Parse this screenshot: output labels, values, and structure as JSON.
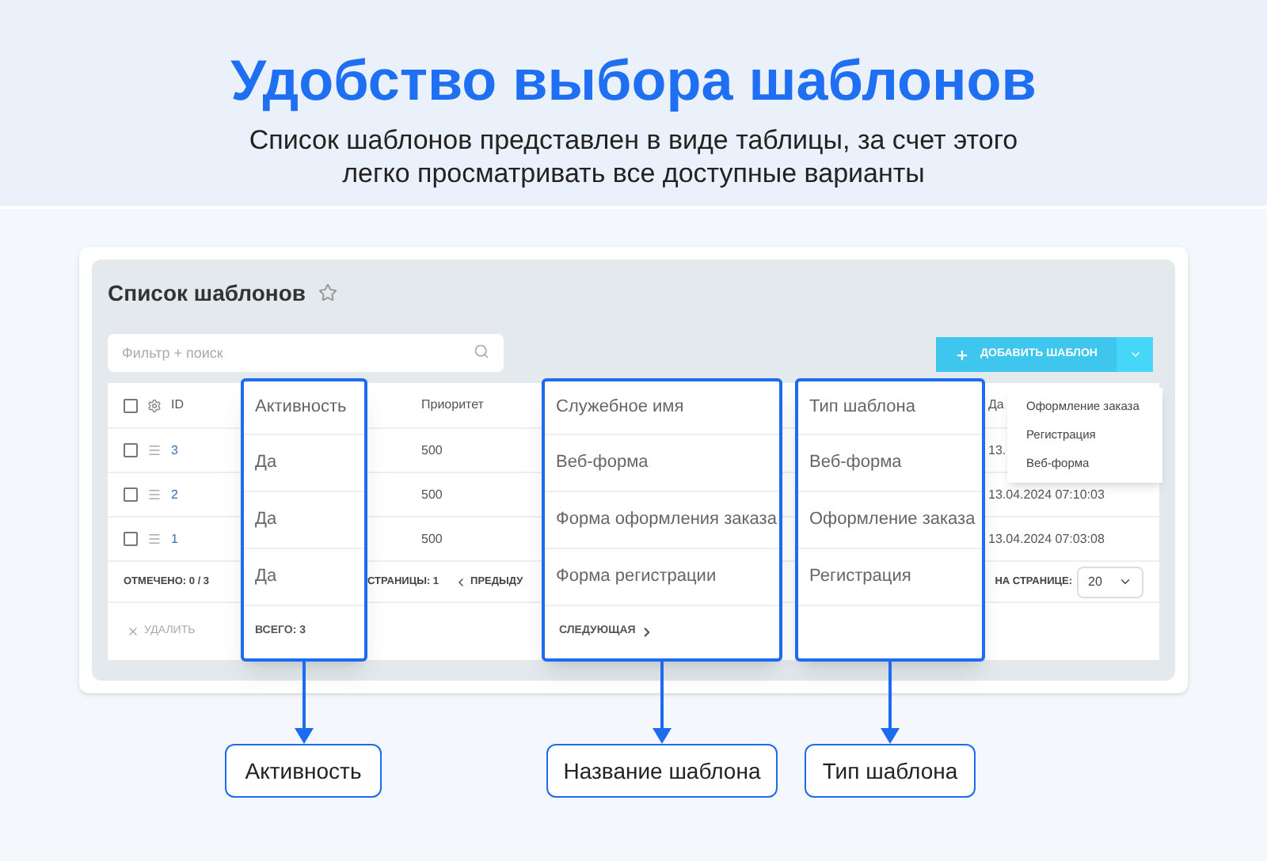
{
  "header": {
    "title": "Удобство выбора шаблонов",
    "subtitle_lines": [
      "Список шаблонов представлен в виде таблицы, за счет этого",
      "легко просматривать все доступные варианты"
    ]
  },
  "panel": {
    "title": "Список шаблонов",
    "favorite": false,
    "search": {
      "placeholder": "Фильтр + поиск"
    },
    "add_button": {
      "label": "ДОБАВИТЬ ШАБЛОН"
    },
    "dropdown": {
      "expanded": true,
      "items": [
        "Оформление заказа",
        "Регистрация",
        "Веб-форма"
      ]
    },
    "table": {
      "select_all_checked": false,
      "columns": {
        "id": "ID",
        "priority": "Приоритет",
        "date": "Да"
      },
      "rows": [
        {
          "checked": false,
          "id": "3",
          "priority": "500",
          "date": "13."
        },
        {
          "checked": false,
          "id": "2",
          "priority": "500",
          "date": "13.04.2024 07:10:03"
        },
        {
          "checked": false,
          "id": "1",
          "priority": "500",
          "date": "13.04.2024 07:03:08"
        }
      ],
      "footer": {
        "selected": "ОТМЕЧЕНО: 0 / 3",
        "pages": "СТРАНИЦЫ: 1",
        "prev": "ПРЕДЫДУ",
        "per_page_label": "НА СТРАНИЦЕ:",
        "per_page_value": "20",
        "delete": "УДАЛИТЬ"
      }
    }
  },
  "callouts": [
    {
      "header": "Активность",
      "cells": [
        "Да",
        "Да",
        "Да"
      ],
      "footer": {
        "kind": "total",
        "text": "ВСЕГО: 3"
      },
      "label": "Активность"
    },
    {
      "header": "Служебное имя",
      "cells": [
        "Веб-форма",
        "Форма оформления заказа",
        "Форма регистрации"
      ],
      "footer": {
        "kind": "next",
        "text": "СЛЕДУЮЩАЯ"
      },
      "label": "Название шаблона"
    },
    {
      "header": "Тип шаблона",
      "cells": [
        "Веб-форма",
        "Оформление заказа",
        "Регистрация"
      ],
      "label": "Тип шаблона"
    }
  ]
}
